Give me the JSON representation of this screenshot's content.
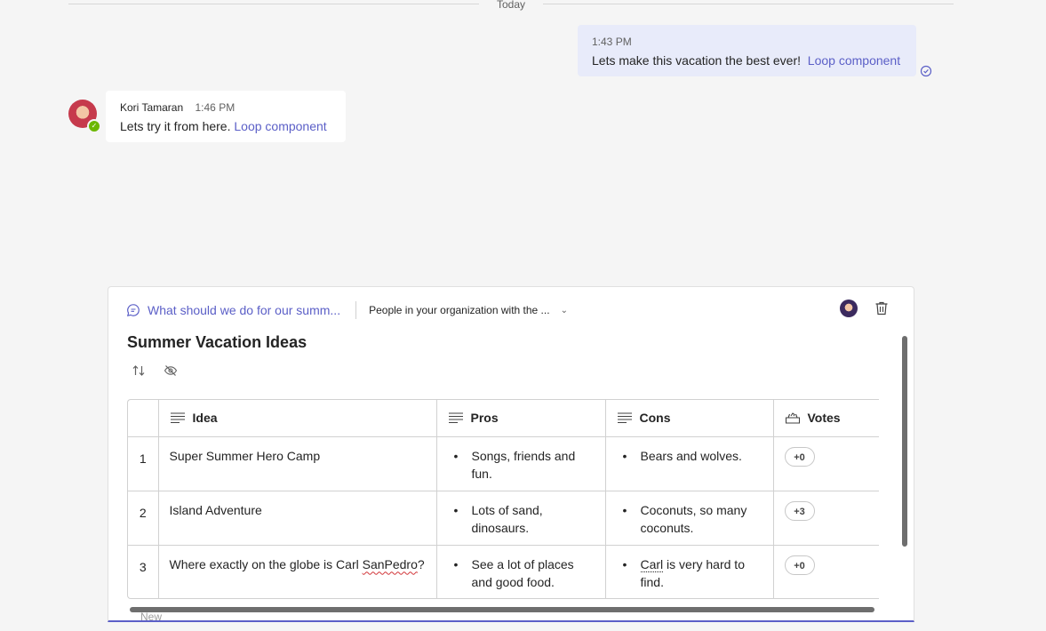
{
  "divider": {
    "label": "Today"
  },
  "own_message": {
    "time": "1:43 PM",
    "text": "Lets make this vacation the best ever!",
    "link": "Loop component"
  },
  "incoming_message": {
    "sender": "Kori Tamaran",
    "time": "1:46 PM",
    "text": "Lets try it from here.",
    "link": "Loop component"
  },
  "loop_card": {
    "chat_link": "What should we do for our summ...",
    "permission": "People in your organization with the ...",
    "title": "Summer Vacation Ideas",
    "table": {
      "headers": [
        "Idea",
        "Pros",
        "Cons",
        "Votes"
      ],
      "rows": [
        {
          "num": "1",
          "idea": "Super Summer Hero Camp",
          "pros": "Songs, friends and fun.",
          "cons": "Bears and wolves.",
          "votes": "+0"
        },
        {
          "num": "2",
          "idea": "Island Adventure",
          "pros": "Lots of sand, dinosaurs.",
          "cons": "Coconuts, so many coconuts.",
          "votes": "+3"
        },
        {
          "num": "3",
          "idea_prefix": "Where exactly on the globe is Carl ",
          "idea_misspelled": "SanPedro",
          "idea_suffix": "?",
          "pros": "See a lot of places and good food.",
          "cons_first": "Carl",
          "cons_rest": " is very hard to find.",
          "votes": "+0"
        }
      ]
    },
    "peek_text": "New"
  },
  "colors": {
    "accent": "#5b5fc7",
    "own_bubble": "#e8ebfa",
    "presence": "#6bb700",
    "background": "#f5f5f5"
  }
}
